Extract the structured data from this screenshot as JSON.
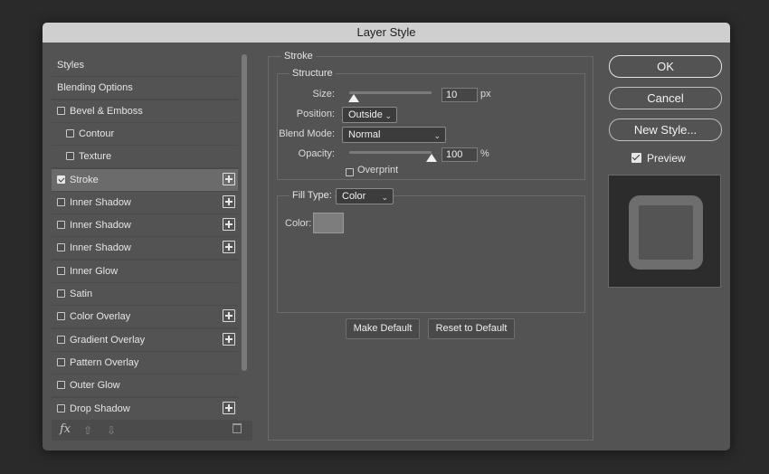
{
  "window": {
    "title": "Layer Style"
  },
  "styles_list": {
    "items": [
      {
        "label": "Styles",
        "checkbox": false,
        "checked": false,
        "indent": false,
        "plus": false,
        "selected": false
      },
      {
        "label": "Blending Options",
        "checkbox": false,
        "checked": false,
        "indent": false,
        "plus": false,
        "selected": false
      },
      {
        "label": "Bevel & Emboss",
        "checkbox": true,
        "checked": false,
        "indent": false,
        "plus": false,
        "selected": false
      },
      {
        "label": "Contour",
        "checkbox": true,
        "checked": false,
        "indent": true,
        "plus": false,
        "selected": false
      },
      {
        "label": "Texture",
        "checkbox": true,
        "checked": false,
        "indent": true,
        "plus": false,
        "selected": false
      },
      {
        "label": "Stroke",
        "checkbox": true,
        "checked": true,
        "indent": false,
        "plus": true,
        "selected": true
      },
      {
        "label": "Inner Shadow",
        "checkbox": true,
        "checked": false,
        "indent": false,
        "plus": true,
        "selected": false
      },
      {
        "label": "Inner Shadow",
        "checkbox": true,
        "checked": false,
        "indent": false,
        "plus": true,
        "selected": false
      },
      {
        "label": "Inner Shadow",
        "checkbox": true,
        "checked": false,
        "indent": false,
        "plus": true,
        "selected": false
      },
      {
        "label": "Inner Glow",
        "checkbox": true,
        "checked": false,
        "indent": false,
        "plus": false,
        "selected": false
      },
      {
        "label": "Satin",
        "checkbox": true,
        "checked": false,
        "indent": false,
        "plus": false,
        "selected": false
      },
      {
        "label": "Color Overlay",
        "checkbox": true,
        "checked": false,
        "indent": false,
        "plus": true,
        "selected": false
      },
      {
        "label": "Gradient Overlay",
        "checkbox": true,
        "checked": false,
        "indent": false,
        "plus": true,
        "selected": false
      },
      {
        "label": "Pattern Overlay",
        "checkbox": true,
        "checked": false,
        "indent": false,
        "plus": false,
        "selected": false
      },
      {
        "label": "Outer Glow",
        "checkbox": true,
        "checked": false,
        "indent": false,
        "plus": false,
        "selected": false
      },
      {
        "label": "Drop Shadow",
        "checkbox": true,
        "checked": false,
        "indent": false,
        "plus": true,
        "selected": false
      }
    ],
    "footer_fx": "fx"
  },
  "stroke": {
    "section_title": "Stroke",
    "structure": {
      "title": "Structure",
      "size_label": "Size:",
      "size_value": "10",
      "size_unit": "px",
      "size_slider_fraction": 0.06,
      "position_label": "Position:",
      "position_value": "Outside",
      "blend_mode_label": "Blend Mode:",
      "blend_mode_value": "Normal",
      "opacity_label": "Opacity:",
      "opacity_value": "100",
      "opacity_unit": "%",
      "opacity_slider_fraction": 1.0,
      "overprint_label": "Overprint",
      "overprint_checked": false
    },
    "fill": {
      "fill_type_label": "Fill Type:",
      "fill_type_value": "Color",
      "color_label": "Color:",
      "color_swatch": "#7d7d7d"
    },
    "make_default": "Make Default",
    "reset_default": "Reset to Default"
  },
  "buttons": {
    "ok": "OK",
    "cancel": "Cancel",
    "new_style": "New Style...",
    "preview_label": "Preview",
    "preview_checked": true
  },
  "icons": {
    "move_up": "arrow-up-icon",
    "move_down": "arrow-down-icon",
    "delete": "trash-icon",
    "chevron": "chevron-down-icon"
  }
}
